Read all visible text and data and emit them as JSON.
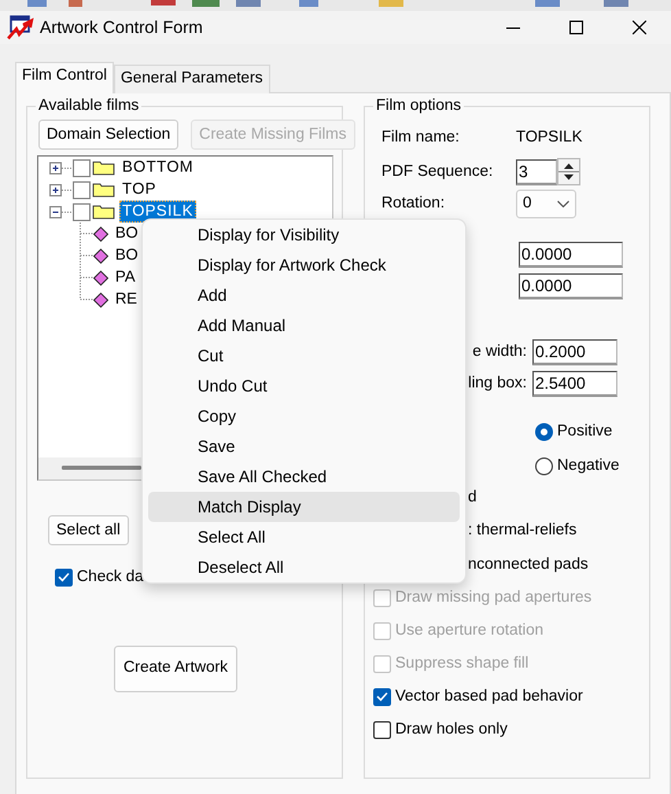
{
  "window": {
    "title": "Artwork Control Form"
  },
  "tabs": [
    {
      "label": "Film Control",
      "selected": true
    },
    {
      "label": "General Parameters",
      "selected": false
    }
  ],
  "available_films": {
    "title": "Available films",
    "buttons": [
      {
        "label": "Domain Selection",
        "disabled": false
      },
      {
        "label": "Create Missing Films",
        "disabled": true
      }
    ],
    "tree": [
      {
        "label": "BOTTOM",
        "checked": false,
        "expanded": false,
        "selected": false
      },
      {
        "label": "TOP",
        "checked": false,
        "expanded": false,
        "selected": false
      },
      {
        "label": "TOPSILK",
        "checked": false,
        "expanded": true,
        "selected": true,
        "children": [
          {
            "label": "BO"
          },
          {
            "label": "BO"
          },
          {
            "label": "PA"
          },
          {
            "label": "RE"
          }
        ]
      }
    ],
    "select_all_button": "Select all",
    "check_option": {
      "label": "Check da",
      "checked": true
    },
    "create_button": "Create Artwork"
  },
  "film_options": {
    "title": "Film options",
    "film_name": {
      "label": "Film name:",
      "value": "TOPSILK"
    },
    "pdf_sequence": {
      "label": "PDF Sequence:",
      "value": "3"
    },
    "rotation": {
      "label": "Rotation:",
      "value": "0"
    },
    "offset_fields": [
      "0.0000",
      "0.0000"
    ],
    "width_fields": [
      {
        "label": "e width:",
        "value": "0.2000"
      },
      {
        "label": "ling box:",
        "value": "2.5400"
      }
    ],
    "polarity": [
      {
        "label": "Positive",
        "selected": true
      },
      {
        "label": "Negative",
        "selected": false
      }
    ],
    "options": [
      {
        "kind": "partial",
        "label": "d"
      },
      {
        "kind": "partial",
        "label": ": thermal-reliefs"
      },
      {
        "kind": "partial",
        "label": "nconnected pads"
      },
      {
        "kind": "checkbox",
        "label": "Draw missing pad apertures",
        "checked": false,
        "disabled": true
      },
      {
        "kind": "checkbox",
        "label": "Use aperture rotation",
        "checked": false,
        "disabled": true
      },
      {
        "kind": "checkbox",
        "label": "Suppress shape fill",
        "checked": false,
        "disabled": true
      },
      {
        "kind": "checkbox",
        "label": "Vector based pad behavior",
        "checked": true,
        "disabled": false
      },
      {
        "kind": "checkbox",
        "label": "Draw holes only",
        "checked": false,
        "disabled": false
      }
    ]
  },
  "context_menu": {
    "items": [
      {
        "label": "Display for Visibility",
        "highlighted": false
      },
      {
        "label": "Display for Artwork Check",
        "highlighted": false
      },
      {
        "label": "Add",
        "highlighted": false
      },
      {
        "label": "Add Manual",
        "highlighted": false
      },
      {
        "label": "Cut",
        "highlighted": false
      },
      {
        "label": "Undo Cut",
        "highlighted": false
      },
      {
        "label": "Copy",
        "highlighted": false
      },
      {
        "label": "Save",
        "highlighted": false
      },
      {
        "label": "Save All Checked",
        "highlighted": false
      },
      {
        "label": "Match Display",
        "highlighted": true
      },
      {
        "label": "Select All",
        "highlighted": false
      },
      {
        "label": "Deselect All",
        "highlighted": false
      }
    ]
  }
}
